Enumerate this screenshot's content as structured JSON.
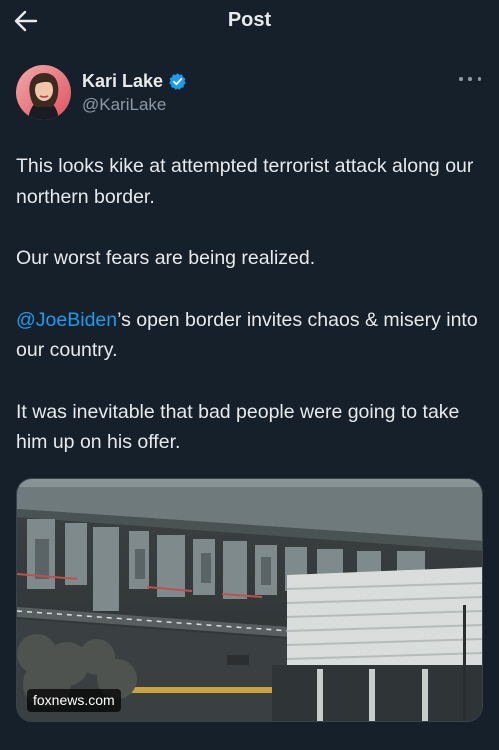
{
  "header": {
    "title": "Post",
    "back_icon": "arrow-left-icon"
  },
  "author": {
    "display_name": "Kari Lake",
    "handle": "@KariLake",
    "verified_icon": "verified-badge-icon",
    "verified_color": "#1d9bf0",
    "more_icon": "more-horizontal-icon"
  },
  "tweet": {
    "paragraph_1": "This looks kike at attempted terrorist attack along our northern border.",
    "paragraph_2": "Our worst fears are being realized.",
    "mention": "@JoeBiden",
    "paragraph_3_rest": "’s open border invites chaos & misery into our country.",
    "paragraph_4": "It was inevitable that bad people were going to take him up on his offer."
  },
  "media": {
    "source_label": "foxnews.com"
  },
  "colors": {
    "background": "#15202b",
    "text": "#e7e9ea",
    "secondary_text": "#8b98a5",
    "link": "#1d9bf0"
  }
}
